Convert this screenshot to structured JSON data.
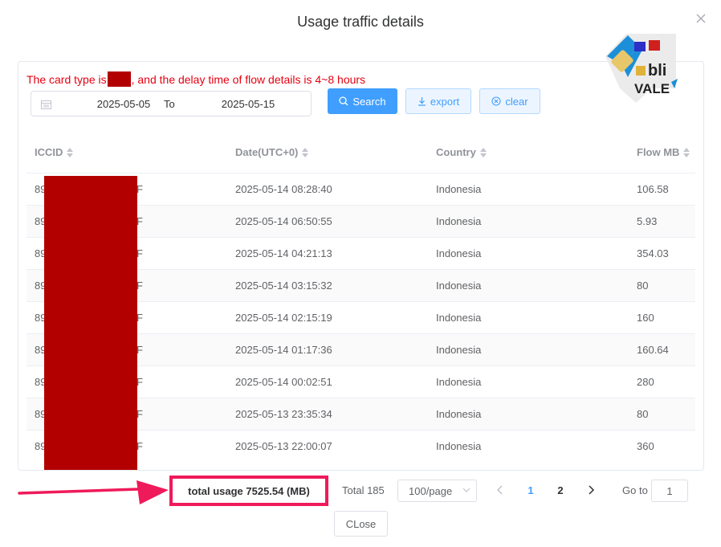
{
  "dialog": {
    "title": "Usage traffic details",
    "close_label": "CLose"
  },
  "notice": {
    "before": "The card type is",
    "after": ", and the delay time of flow details is 4~8 hours"
  },
  "date_range": {
    "start": "2025-05-05",
    "separator": "To",
    "end": "2025-05-15"
  },
  "actions": {
    "search": "Search",
    "export": "export",
    "clear": "clear"
  },
  "logo": {
    "top_text": "bli",
    "bottom_text": "VALE"
  },
  "table": {
    "columns": [
      "ICCID",
      "Date(UTC+0)",
      "Country",
      "Flow MB"
    ],
    "rows": [
      {
        "iccid_prefix": "89",
        "iccid_suffix": "F",
        "date": "2025-05-14 08:28:40",
        "country": "Indonesia",
        "flow": "106.58"
      },
      {
        "iccid_prefix": "89",
        "iccid_suffix": "F",
        "date": "2025-05-14 06:50:55",
        "country": "Indonesia",
        "flow": "5.93"
      },
      {
        "iccid_prefix": "89",
        "iccid_suffix": "F",
        "date": "2025-05-14 04:21:13",
        "country": "Indonesia",
        "flow": "354.03"
      },
      {
        "iccid_prefix": "89",
        "iccid_suffix": "F",
        "date": "2025-05-14 03:15:32",
        "country": "Indonesia",
        "flow": "80"
      },
      {
        "iccid_prefix": "89",
        "iccid_suffix": "F",
        "date": "2025-05-14 02:15:19",
        "country": "Indonesia",
        "flow": "160"
      },
      {
        "iccid_prefix": "89",
        "iccid_suffix": "F",
        "date": "2025-05-14 01:17:36",
        "country": "Indonesia",
        "flow": "160.64"
      },
      {
        "iccid_prefix": "89",
        "iccid_suffix": "F",
        "date": "2025-05-14 00:02:51",
        "country": "Indonesia",
        "flow": "280"
      },
      {
        "iccid_prefix": "89",
        "iccid_suffix": "F",
        "date": "2025-05-13 23:35:34",
        "country": "Indonesia",
        "flow": "80"
      },
      {
        "iccid_prefix": "89",
        "iccid_suffix": "F",
        "date": "2025-05-13 22:00:07",
        "country": "Indonesia",
        "flow": "360"
      }
    ]
  },
  "footer": {
    "total_usage": "total usage 7525.54 (MB)",
    "total": "Total 185",
    "page_size": "100/page",
    "pages": [
      "1",
      "2"
    ],
    "current_page": "1",
    "goto_label": "Go to",
    "goto_value": "1"
  },
  "colors": {
    "accent": "#409eff",
    "notice": "#e60012",
    "redaction": "#b20000",
    "highlight": "#ef1a5a"
  }
}
